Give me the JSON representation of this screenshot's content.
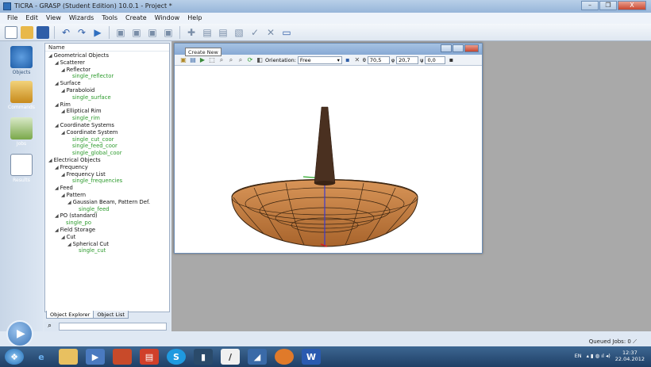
{
  "window": {
    "title": "TICRA - GRASP (Student Edition) 10.0.1 - Project *",
    "controls": [
      "–",
      "❐",
      "X"
    ]
  },
  "menu": [
    "File",
    "Edit",
    "View",
    "Wizards",
    "Tools",
    "Create",
    "Window",
    "Help"
  ],
  "toolbar": {
    "icons": [
      "new-document-icon",
      "open-folder-icon",
      "save-icon",
      "undo-icon",
      "redo-icon",
      "run-icon",
      "cut-icon",
      "copy-icon",
      "paste-icon",
      "delete-icon",
      "add-icon",
      "edit-icon",
      "duplicate-icon",
      "check-icon",
      "close-icon",
      "window-icon"
    ]
  },
  "leftbar": [
    {
      "label": "Objects",
      "color": "#2f6fb8"
    },
    {
      "label": "Commands",
      "color": "#d99a2a"
    },
    {
      "label": "Jobs",
      "color": "#6a9a3a"
    },
    {
      "label": "Results",
      "color": "#3a6aa8"
    }
  ],
  "tree": {
    "header": "Name",
    "nodes": [
      {
        "label": "Geometrical Objects",
        "depth": 0,
        "leaf": false
      },
      {
        "label": "Scatterer",
        "depth": 1,
        "leaf": false
      },
      {
        "label": "Reflector",
        "depth": 2,
        "leaf": false
      },
      {
        "label": "single_reflector",
        "depth": 3,
        "leaf": true
      },
      {
        "label": "Surface",
        "depth": 1,
        "leaf": false
      },
      {
        "label": "Paraboloid",
        "depth": 2,
        "leaf": false
      },
      {
        "label": "single_surface",
        "depth": 3,
        "leaf": true
      },
      {
        "label": "Rim",
        "depth": 1,
        "leaf": false
      },
      {
        "label": "Elliptical Rim",
        "depth": 2,
        "leaf": false
      },
      {
        "label": "single_rim",
        "depth": 3,
        "leaf": true
      },
      {
        "label": "Coordinate Systems",
        "depth": 1,
        "leaf": false
      },
      {
        "label": "Coordinate System",
        "depth": 2,
        "leaf": false
      },
      {
        "label": "single_cut_coor",
        "depth": 3,
        "leaf": true
      },
      {
        "label": "single_feed_coor",
        "depth": 3,
        "leaf": true
      },
      {
        "label": "single_global_coor",
        "depth": 3,
        "leaf": true
      },
      {
        "label": "Electrical Objects",
        "depth": 0,
        "leaf": false
      },
      {
        "label": "Frequency",
        "depth": 1,
        "leaf": false
      },
      {
        "label": "Frequency List",
        "depth": 2,
        "leaf": false
      },
      {
        "label": "single_frequencies",
        "depth": 3,
        "leaf": true
      },
      {
        "label": "Feed",
        "depth": 1,
        "leaf": false
      },
      {
        "label": "Pattern",
        "depth": 2,
        "leaf": false
      },
      {
        "label": "Gaussian Beam, Pattern Def.",
        "depth": 3,
        "leaf": false
      },
      {
        "label": "single_feed",
        "depth": 4,
        "leaf": true
      },
      {
        "label": "PO (standard)",
        "depth": 1,
        "leaf": false
      },
      {
        "label": "single_po",
        "depth": 2,
        "leaf": true
      },
      {
        "label": "Field Storage",
        "depth": 1,
        "leaf": false
      },
      {
        "label": "Cut",
        "depth": 2,
        "leaf": false
      },
      {
        "label": "Spherical Cut",
        "depth": 3,
        "leaf": false
      },
      {
        "label": "single_cut",
        "depth": 4,
        "leaf": true
      }
    ]
  },
  "tabs": [
    "Object Explorer",
    "Object List"
  ],
  "viewer": {
    "tooltip": "Create New",
    "orientation_label": "Orientation:",
    "orientation_value": "Free",
    "theta_label": "θ",
    "theta_value": "70,5",
    "phi_label": "φ",
    "phi_value": "20,7",
    "psi_label": "ψ",
    "psi_value": "0,0"
  },
  "colors": {
    "dish": "#c98448",
    "dish_stroke": "#3a2410",
    "feed": "#4a3020",
    "axis_blue": "#3b3bcf",
    "axis_green": "#2aa82a",
    "axis_red": "#d02020",
    "leaf_text": "#2b9a2b"
  },
  "status": {
    "queued": "Queued Jobs: 0"
  },
  "taskbar": {
    "apps": [
      "windows-start-icon",
      "ie-icon",
      "folder-icon",
      "media-icon",
      "app-icon",
      "presentation-icon",
      "skype-icon",
      "terminal-icon",
      "paint-icon",
      "grasp-icon",
      "firefox-icon",
      "word-icon"
    ],
    "lang": "EN",
    "time": "12:37",
    "date": "22.04.2012"
  }
}
